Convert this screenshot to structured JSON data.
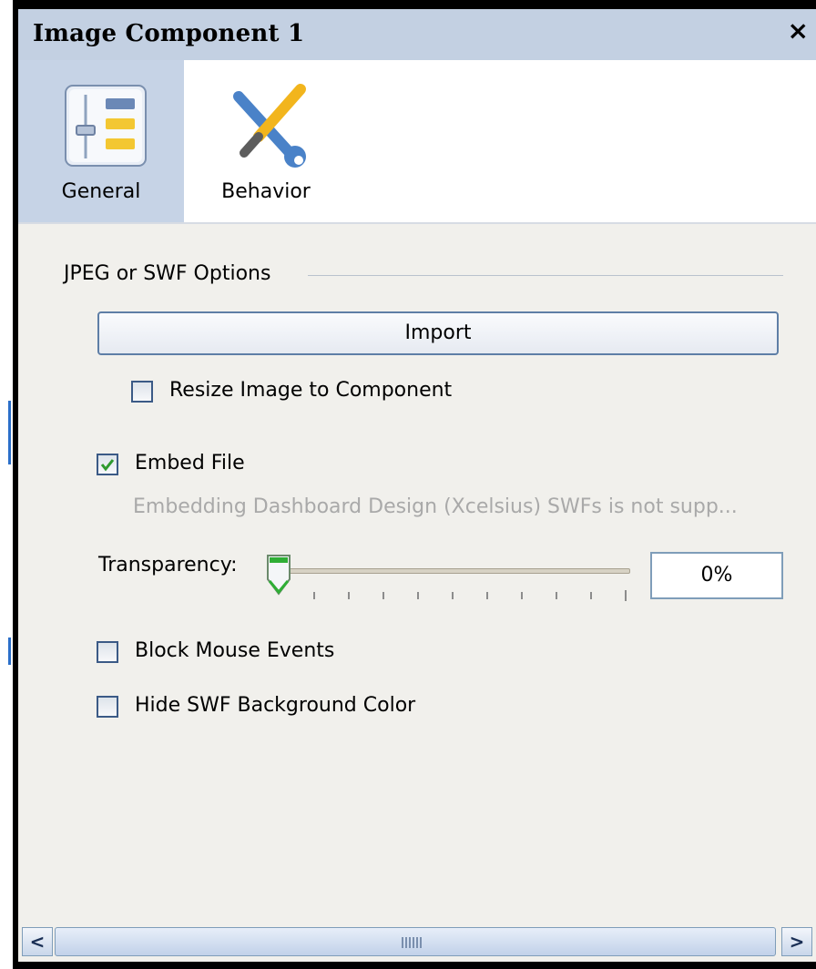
{
  "window": {
    "title": "Image Component 1",
    "close_glyph": "×"
  },
  "tabs": [
    {
      "label": "General",
      "icon": "general-properties-icon",
      "selected": true
    },
    {
      "label": "Behavior",
      "icon": "behavior-tools-icon",
      "selected": false
    }
  ],
  "general": {
    "group_title": "JPEG or SWF Options",
    "import_button": "Import",
    "resize_checkbox": {
      "label": "Resize Image to Component",
      "checked": false
    },
    "embed_checkbox": {
      "label": "Embed File",
      "checked": true
    },
    "embed_note": "Embedding Dashboard Design (Xcelsius) SWFs is not supp...",
    "transparency": {
      "label": "Transparency:",
      "value_text": "0%",
      "value": 0
    },
    "block_mouse_checkbox": {
      "label": "Block Mouse Events",
      "checked": false
    },
    "hide_bg_checkbox": {
      "label": "Hide SWF Background Color",
      "checked": false
    }
  },
  "scrollbar": {
    "left_glyph": "<",
    "right_glyph": ">"
  },
  "colors": {
    "title_bar": "#c3d0e2",
    "selected_tab": "#c6d3e6",
    "panel_bg": "#f1f0ec",
    "check_green": "#2e9a2e",
    "slider_green": "#2fae35"
  }
}
